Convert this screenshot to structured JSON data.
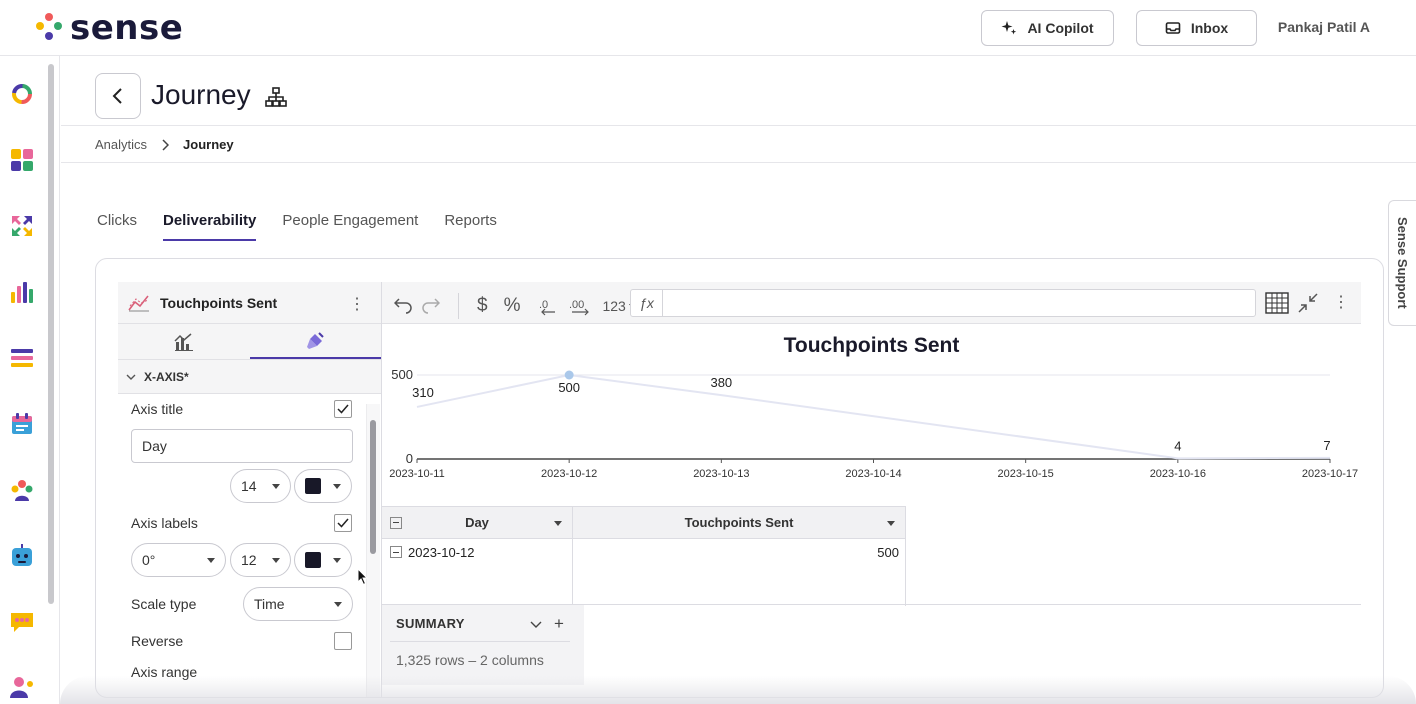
{
  "app": {
    "logo_text": "sense",
    "user_name": "Pankaj Patil A"
  },
  "header": {
    "copilot_label": "AI Copilot",
    "inbox_label": "Inbox"
  },
  "page": {
    "title": "Journey"
  },
  "breadcrumb": {
    "items": [
      "Analytics",
      "Journey"
    ]
  },
  "tabs": [
    "Clicks",
    "Deliverability",
    "People Engagement",
    "Reports"
  ],
  "support": {
    "label": "Sense Support"
  },
  "editor": {
    "chart_name": "Touchpoints Sent",
    "section": "X-AXIS*",
    "axis_title_label": "Axis title",
    "axis_title_value": "Day",
    "axis_title_size": "14",
    "axis_labels_label": "Axis labels",
    "axis_labels_angle": "0°",
    "axis_labels_size": "12",
    "scale_type_label": "Scale type",
    "scale_type_value": "Time",
    "reverse_label": "Reverse",
    "axis_range_label": "Axis range"
  },
  "toolbar": {
    "number_format": "123"
  },
  "chart_data": {
    "type": "line",
    "title": "Touchpoints Sent",
    "x": [
      "2023-10-11",
      "2023-10-12",
      "2023-10-13",
      "2023-10-16",
      "2023-10-17"
    ],
    "x_ticks": [
      "2023-10-11",
      "2023-10-12",
      "2023-10-13",
      "2023-10-14",
      "2023-10-15",
      "2023-10-16",
      "2023-10-17"
    ],
    "values": [
      310,
      500,
      380,
      4,
      7
    ],
    "y_ticks": [
      0,
      500
    ],
    "ylim": [
      0,
      500
    ],
    "highlight_index": 1,
    "colors": {
      "line": "#e3e5f2",
      "highlight": "#aac8ea"
    }
  },
  "table": {
    "columns": [
      "Day",
      "Touchpoints Sent"
    ],
    "rows": [
      {
        "day": "2023-10-12",
        "value": "500"
      }
    ]
  },
  "summary": {
    "title": "SUMMARY",
    "info": "1,325 rows – 2 columns"
  }
}
